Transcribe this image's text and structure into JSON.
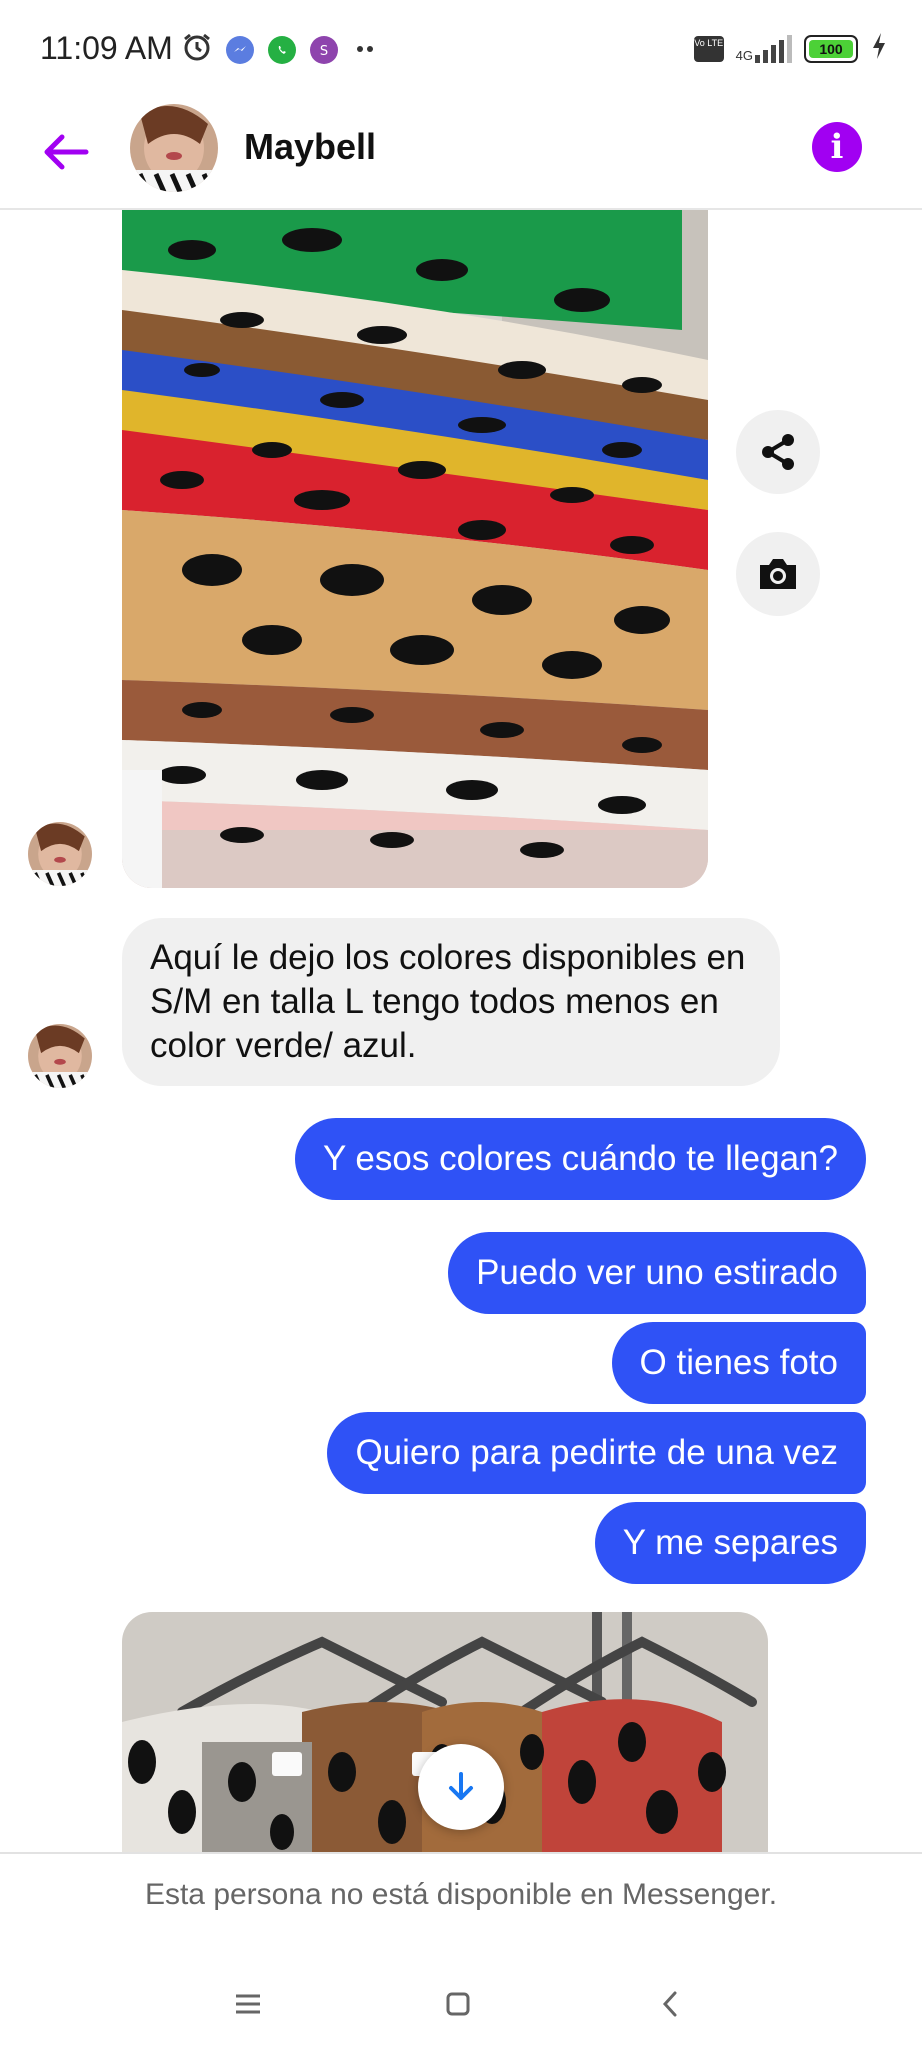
{
  "status_bar": {
    "time": "11:09 AM",
    "network": "4G",
    "volte": "Vo LTE",
    "battery": "100",
    "notification_icons": [
      "alarm-icon",
      "messenger-icon",
      "whatsapp-icon",
      "app-icon",
      "more-dots-icon"
    ]
  },
  "header": {
    "contact_name": "Maybell",
    "back_icon": "arrow-left-icon",
    "info_icon": "info-icon",
    "info_glyph": "i"
  },
  "messages": [
    {
      "type": "image",
      "from": "contact",
      "content": "photo of stacked leopard-print sweaters"
    },
    {
      "type": "text",
      "from": "contact",
      "text": "Aquí le dejo los colores disponibles en S/M en talla L tengo todos menos en color verde/ azul."
    },
    {
      "type": "text",
      "from": "me",
      "text": "Y esos colores cuándo te llegan?"
    },
    {
      "type": "text",
      "from": "me",
      "text": "Puedo ver uno estirado"
    },
    {
      "type": "text",
      "from": "me",
      "text": "O tienes foto"
    },
    {
      "type": "text",
      "from": "me",
      "text": "Quiero para pedirte de una vez"
    },
    {
      "type": "text",
      "from": "me",
      "text": "Y me separes"
    },
    {
      "type": "image",
      "from": "contact",
      "content": "photo of leopard-print cardigans on hangers"
    }
  ],
  "footer": {
    "unavailable_text": "Esta persona no está disponible en Messenger."
  },
  "colors": {
    "accent_purple": "#a100f2",
    "outgoing_bubble": "#2f52f6",
    "incoming_bubble": "#f0f0f0"
  }
}
